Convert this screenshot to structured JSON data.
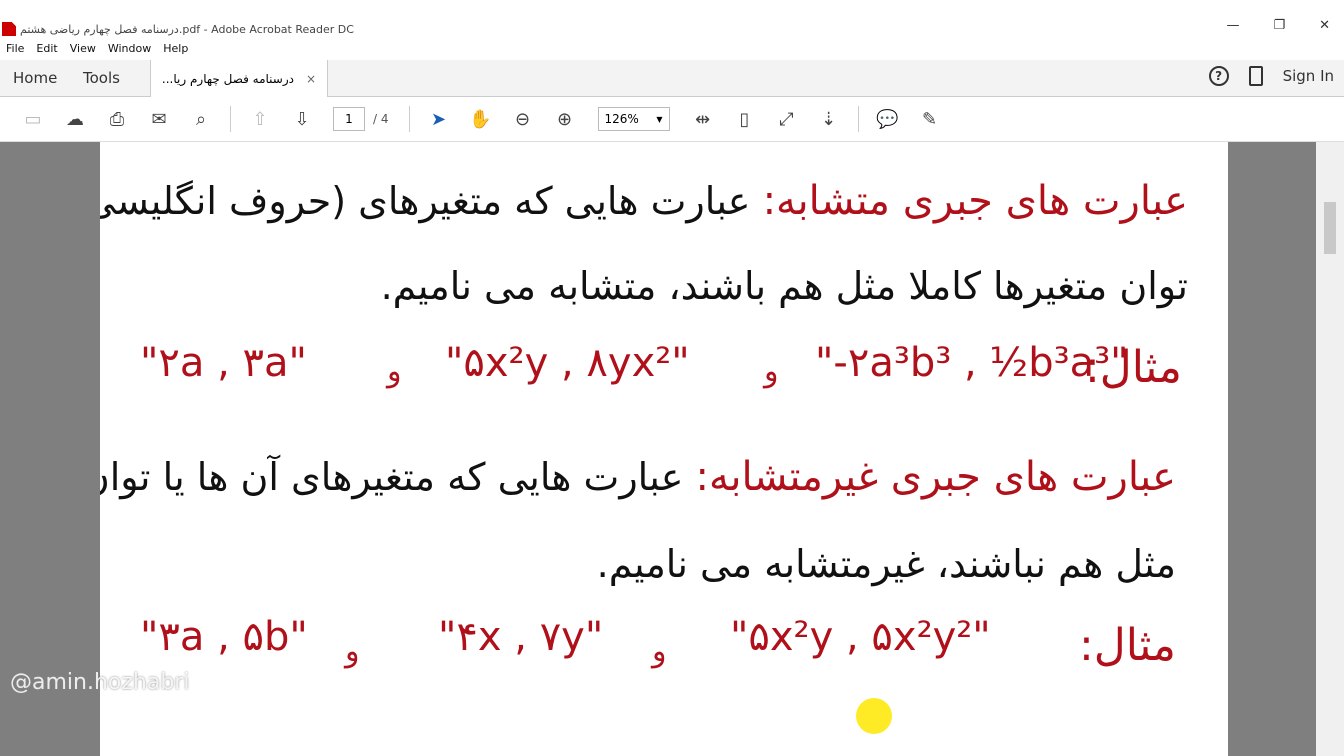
{
  "window": {
    "title": "درسنامه فصل چهارم ریاضی هشتم.pdf - Adobe Acrobat Reader DC",
    "controls": [
      "—",
      "❐",
      "✕"
    ]
  },
  "menu": [
    "File",
    "Edit",
    "View",
    "Window",
    "Help"
  ],
  "tabs": {
    "home": "Home",
    "tools": "Tools",
    "document": "درسنامه فصل چهارم ریا...",
    "close": "×",
    "sign_in": "Sign In",
    "help": "?"
  },
  "toolbar": {
    "page_current": "1",
    "page_total": "/ 4",
    "zoom": "126%"
  },
  "document": {
    "line1_title": "عبارت های جبری متشابه:",
    "line1_text": "عبارت هایی که متغیرهای (حروف انگلیسی) آن ها و",
    "line2": "توان متغیرها کاملا مثل هم باشند، متشابه می نامیم.",
    "example_label": "مثال:",
    "ex1": [
      "\"-۲a³b³ , ½b³a³\"",
      "و",
      "\"۵x²y , ۸yx²\"",
      "و",
      "\"۲a , ۳a\""
    ],
    "line4_title": "عبارت های جبری غیرمتشابه:",
    "line4_text": "عبارت هایی که متغیرهای آن ها یا توان متغیرها",
    "line5": "مثل هم نباشند، غیرمتشابه می نامیم.",
    "ex2": [
      "\"۵x²y , ۵x²y²\"",
      "و",
      "\"۴x , ۷y\"",
      "و",
      "\"۳a , ۵b\""
    ]
  },
  "watermark": "@amin.hozhabri"
}
